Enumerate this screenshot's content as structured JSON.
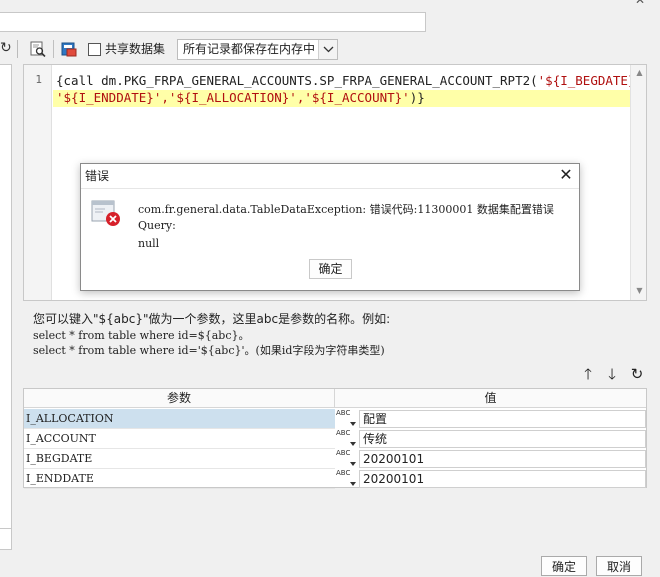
{
  "toolbar": {
    "share_dataset_label": "共享数据集",
    "storage_option": "所有记录都保存在内存中"
  },
  "editor": {
    "line_number": "1",
    "code_line1": "{call dm.PKG_FRPA_GENERAL_ACCOUNTS.SP_FRPA_GENERAL_ACCOUNT_RPT2(",
    "code_line1_str": "'${I_BEGDATE}',",
    "code_line2_str": "'${I_ENDDATE}','${I_ALLOCATION}','${I_ACCOUNT}'",
    "code_line2_end": ")}"
  },
  "hint": {
    "line1": "您可以键入\"${abc}\"做为一个参数，这里abc是参数的名称。例如:",
    "line2": "select * from table where id=${abc}。",
    "line3": "select * from table where id='${abc}'。(如果id字段为字符串类型)"
  },
  "params": {
    "header_param": "参数",
    "header_value": "值",
    "type_label": "ABC",
    "rows": [
      {
        "name": "I_ALLOCATION",
        "value": "配置"
      },
      {
        "name": "I_ACCOUNT",
        "value": "传统"
      },
      {
        "name": "I_BEGDATE",
        "value": "20200101"
      },
      {
        "name": "I_ENDDATE",
        "value": "20200101"
      }
    ]
  },
  "dialog": {
    "title": "错误",
    "message1": "com.fr.general.data.TableDataException: 错误代码:11300001 数据集配置错误",
    "message2": "Query:",
    "message3": "null",
    "ok_label": "确定"
  },
  "footer": {
    "ok_label": "确定",
    "cancel_label": "取消"
  },
  "colors": {
    "highlight_line": "#ffffa8",
    "string_literal": "#b01010",
    "selected_row": "#cde0ee",
    "error_red": "#d6202a"
  }
}
